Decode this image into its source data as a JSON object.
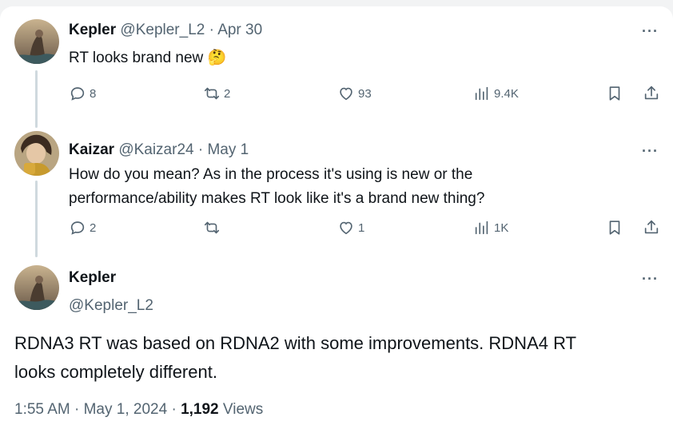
{
  "tweets": [
    {
      "name": "Kepler",
      "handle": "@Kepler_L2",
      "separator": "·",
      "date": "Apr 30",
      "text": "RT looks brand new",
      "emoji": "🤔",
      "replies": "8",
      "retweets": "2",
      "likes": "93",
      "views": "9.4K",
      "more": "···"
    },
    {
      "name": "Kaizar",
      "handle": "@Kaizar24",
      "separator": "·",
      "date": "May 1",
      "text_line1": "How do you mean? As in the process it's using is new or the",
      "text_line2": "performance/ability makes RT look like it's a brand new thing?",
      "replies": "2",
      "retweets": "",
      "likes": "1",
      "views": "1K",
      "more": "···"
    }
  ],
  "main": {
    "name": "Kepler",
    "handle": "@Kepler_L2",
    "text_line1": "RDNA3 RT was based on RDNA2 with some improvements. RDNA4 RT",
    "text_line2": "looks completely different.",
    "time": "1:55 AM",
    "separator": "·",
    "date": "May 1, 2024",
    "views_count": "1,192",
    "views_label": "Views",
    "more": "···"
  },
  "colors": {
    "text_primary": "#0f1419",
    "text_secondary": "#536471",
    "thread_line": "#cfd9de",
    "background": "#ffffff"
  }
}
